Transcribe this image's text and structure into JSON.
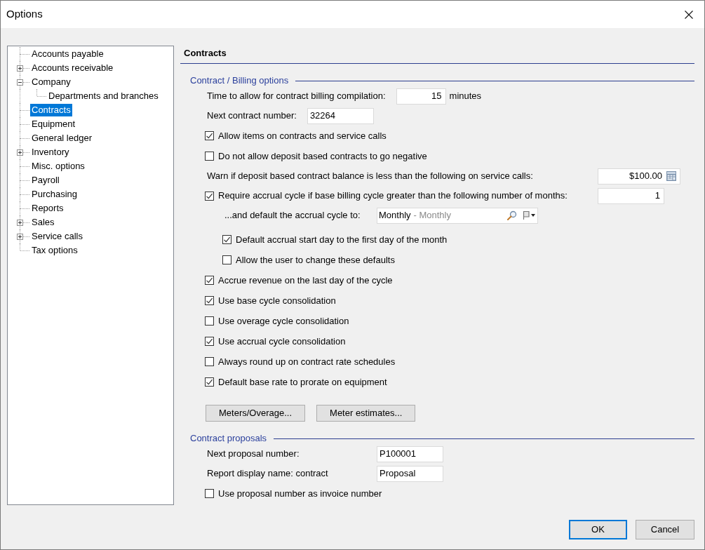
{
  "window": {
    "title": "Options"
  },
  "tree": [
    {
      "label": "Accounts payable",
      "kind": "leaf",
      "selected": false
    },
    {
      "label": "Accounts receivable",
      "kind": "branch",
      "expanded": false,
      "selected": false
    },
    {
      "label": "Company",
      "kind": "branch",
      "expanded": true,
      "selected": false,
      "children": [
        {
          "label": "Departments and branches",
          "kind": "leaf",
          "selected": false
        }
      ]
    },
    {
      "label": "Contracts",
      "kind": "leaf",
      "selected": true
    },
    {
      "label": "Equipment",
      "kind": "leaf",
      "selected": false
    },
    {
      "label": "General ledger",
      "kind": "leaf",
      "selected": false
    },
    {
      "label": "Inventory",
      "kind": "branch",
      "expanded": false,
      "selected": false
    },
    {
      "label": "Misc. options",
      "kind": "leaf",
      "selected": false
    },
    {
      "label": "Payroll",
      "kind": "leaf",
      "selected": false
    },
    {
      "label": "Purchasing",
      "kind": "leaf",
      "selected": false
    },
    {
      "label": "Reports",
      "kind": "leaf",
      "selected": false
    },
    {
      "label": "Sales",
      "kind": "branch",
      "expanded": false,
      "selected": false
    },
    {
      "label": "Service calls",
      "kind": "branch",
      "expanded": false,
      "selected": false
    },
    {
      "label": "Tax options",
      "kind": "leaf",
      "selected": false
    }
  ],
  "page": {
    "title": "Contracts",
    "sections": [
      {
        "title": "Contract / Billing options",
        "rows": [
          {
            "kind": "number",
            "label": "Time to allow for contract billing compilation:",
            "value": "15",
            "unit": "minutes"
          },
          {
            "kind": "text",
            "label": "Next contract number:",
            "value": "32264"
          },
          {
            "kind": "checkbox",
            "label": "Allow items on contracts and service calls",
            "checked": true
          },
          {
            "kind": "checkbox",
            "label": "Do not allow deposit based contracts to go negative",
            "checked": false
          },
          {
            "kind": "currency",
            "label": "Warn if deposit based contract balance is less than the following on service calls:",
            "value": "$100.00"
          },
          {
            "kind": "checkbox_number",
            "label": "Require accrual cycle if base billing cycle greater than the following number of months:",
            "checked": true,
            "value": "1",
            "children": [
              {
                "kind": "lookup",
                "label": "...and default the accrual cycle to:",
                "value": "Monthly",
                "description": "- Monthly"
              },
              {
                "kind": "checkbox",
                "label": "Default accrual start day to the first day of the month",
                "checked": true
              },
              {
                "kind": "checkbox",
                "label": "Allow the user to change these defaults",
                "checked": false
              }
            ]
          },
          {
            "kind": "checkbox",
            "label": "Accrue revenue on the last day of the cycle",
            "checked": true
          },
          {
            "kind": "checkbox",
            "label": "Use base cycle consolidation",
            "checked": true
          },
          {
            "kind": "checkbox",
            "label": "Use overage cycle consolidation",
            "checked": false
          },
          {
            "kind": "checkbox",
            "label": "Use accrual cycle consolidation",
            "checked": true
          },
          {
            "kind": "checkbox",
            "label": "Always round up on contract rate schedules",
            "checked": false
          },
          {
            "kind": "checkbox",
            "label": "Default base rate to prorate on equipment",
            "checked": true
          },
          {
            "kind": "buttons",
            "buttons": [
              "Meters/Overage...",
              "Meter estimates..."
            ]
          }
        ]
      },
      {
        "title": "Contract proposals",
        "rows": [
          {
            "kind": "text",
            "label": "Next proposal number:",
            "value": "P100001"
          },
          {
            "kind": "text",
            "label": "Report display name: contract",
            "value": "Proposal"
          },
          {
            "kind": "checkbox",
            "label": "Use proposal number as invoice number",
            "checked": false
          }
        ]
      }
    ]
  },
  "buttons": [
    {
      "label": "OK",
      "focused": true
    },
    {
      "label": "Cancel",
      "focused": false
    }
  ]
}
